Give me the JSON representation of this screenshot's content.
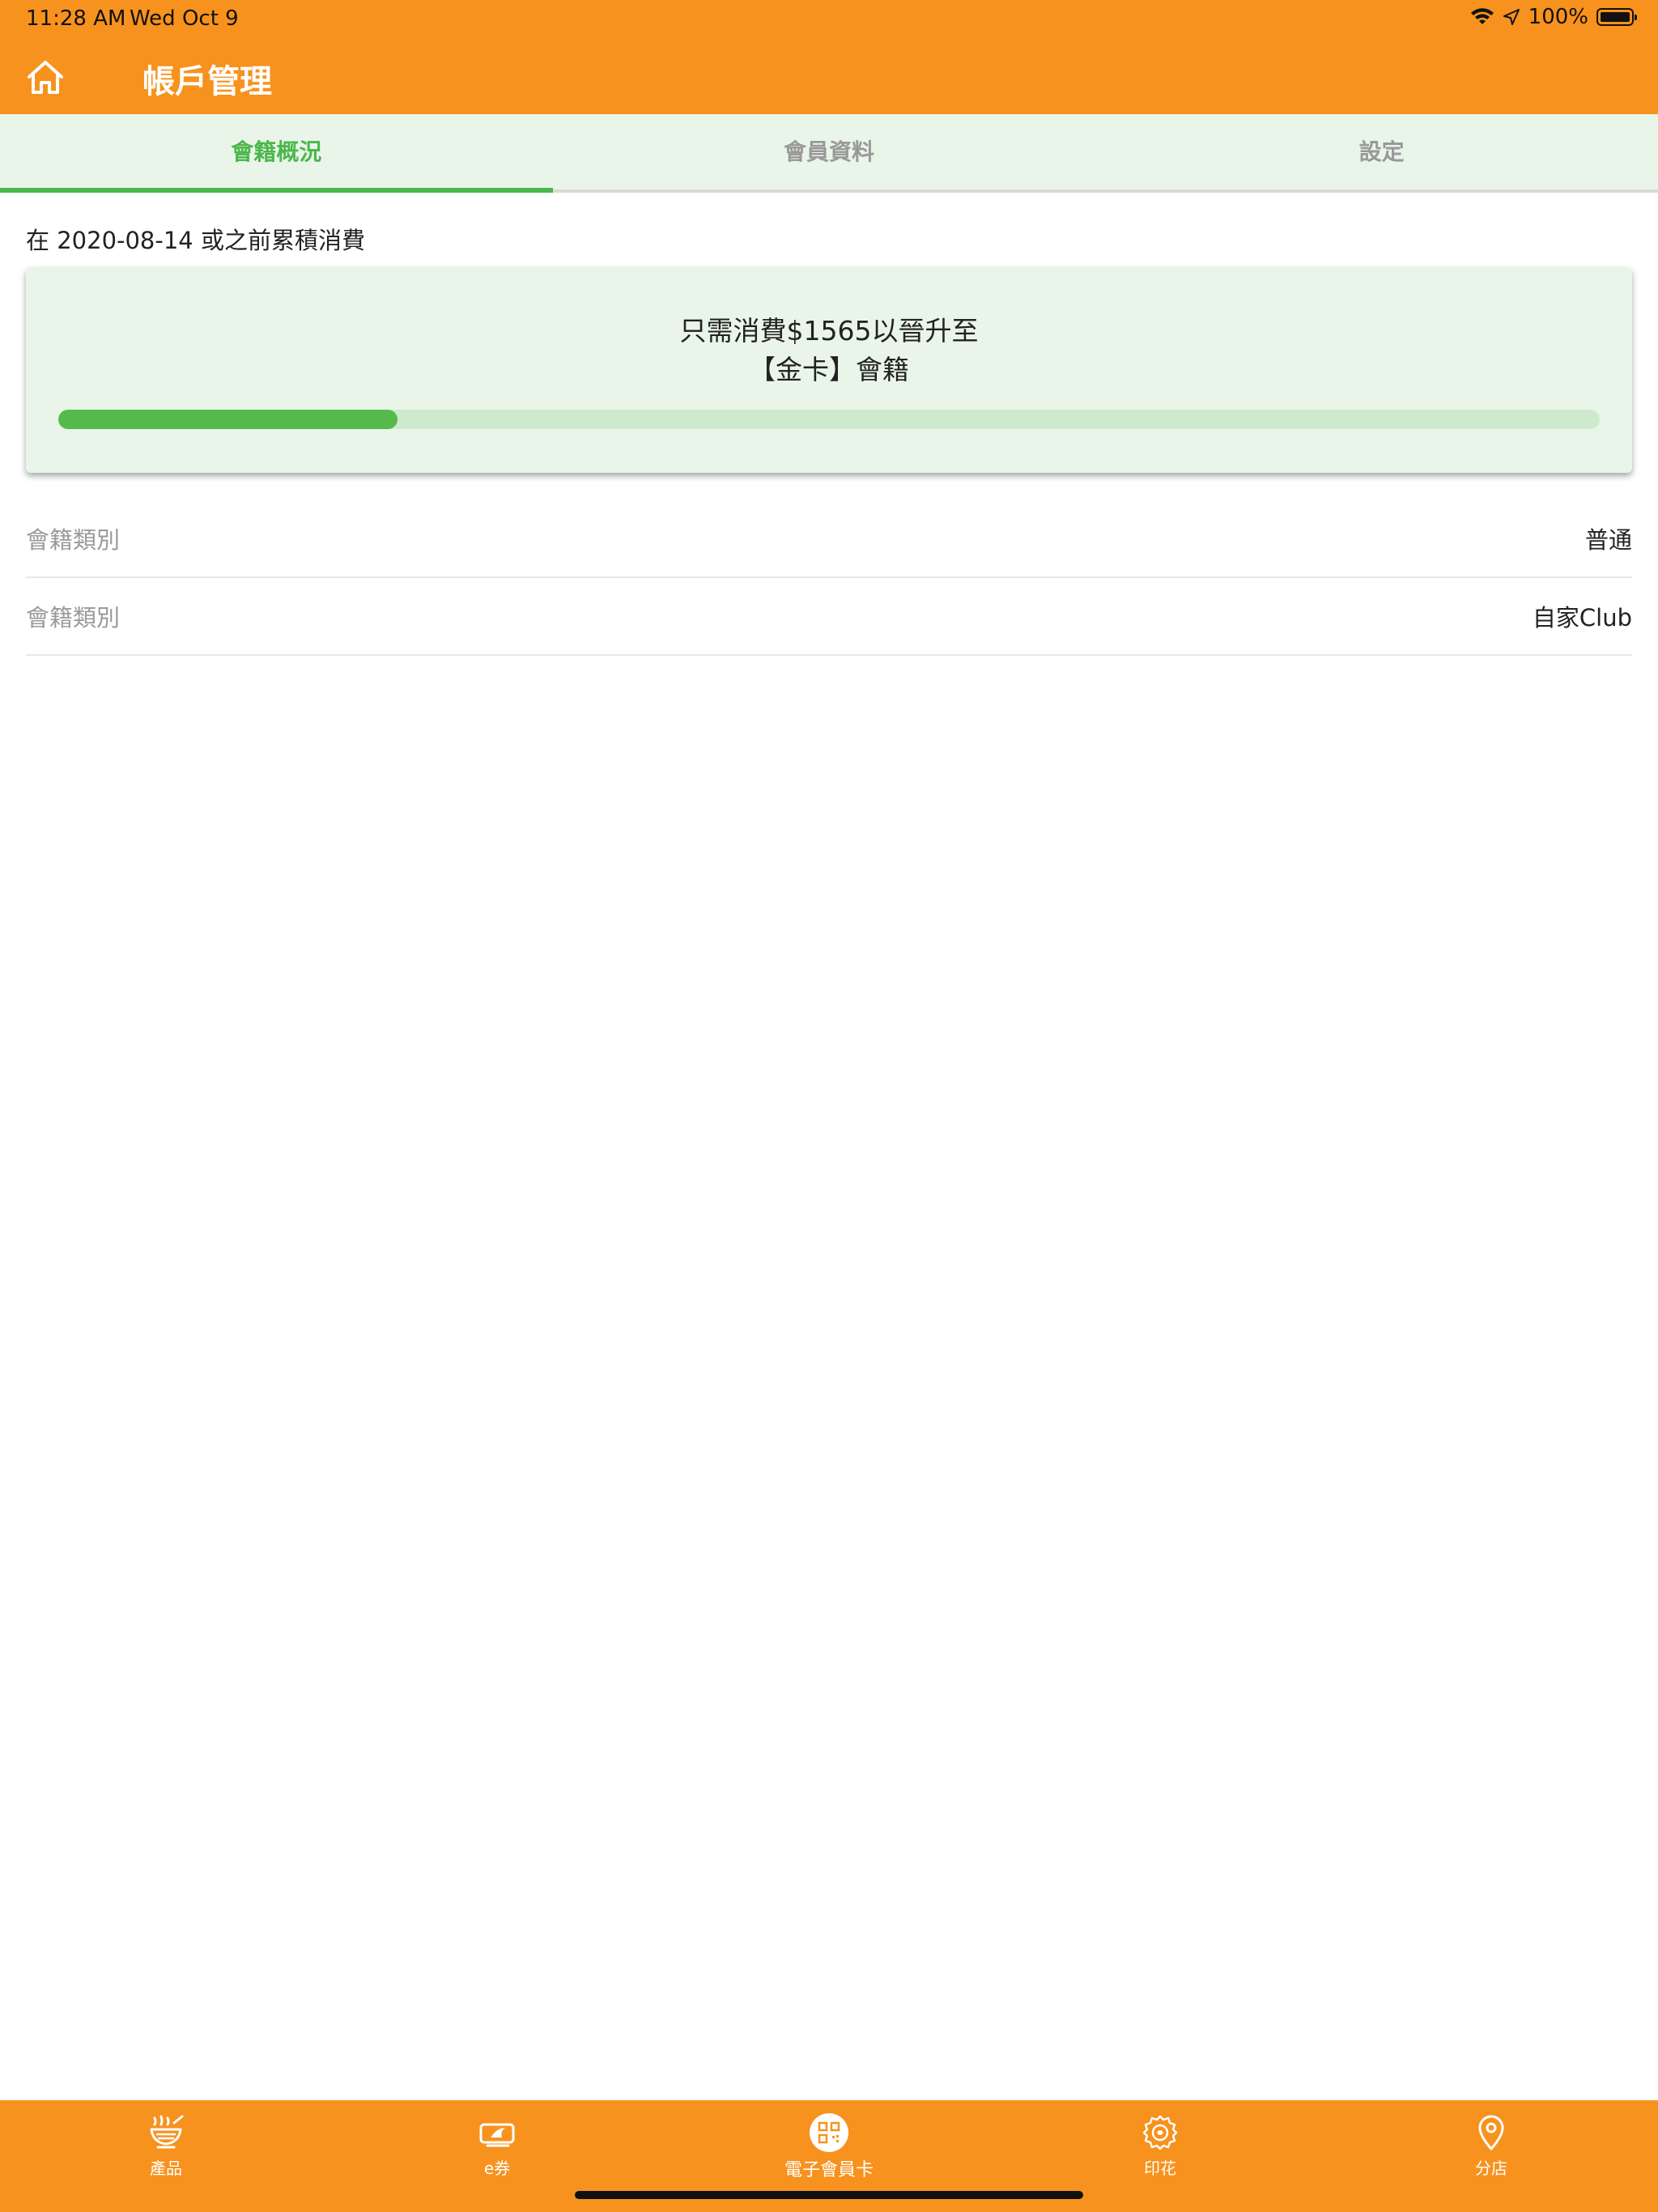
{
  "status_bar": {
    "time": "11:28 AM",
    "date": "Wed Oct 9",
    "battery": "100%"
  },
  "header": {
    "title": "帳戶管理",
    "home_icon": "home-icon"
  },
  "tabs": [
    {
      "label": "會籍概況",
      "active": true
    },
    {
      "label": "會員資料",
      "active": false
    },
    {
      "label": "設定",
      "active": false
    }
  ],
  "summary": {
    "since_text": "在 2020-08-14 或之前累積消費",
    "upgrade_line1": "只需消費$1565以晉升至",
    "upgrade_line2": "【金卡】會籍",
    "progress": 0.22
  },
  "info_rows": [
    {
      "label": "會籍類別",
      "value": "普通"
    },
    {
      "label": "會籍類別",
      "value": "自家Club"
    }
  ],
  "bottom_nav": [
    {
      "label": "產品",
      "icon": "noodle-bowl-icon"
    },
    {
      "label": "e券",
      "icon": "coupon-icon"
    },
    {
      "label": "電子會員卡",
      "icon": "qr-code-icon"
    },
    {
      "label": "印花",
      "icon": "stamp-icon"
    },
    {
      "label": "分店",
      "icon": "location-pin-icon"
    }
  ],
  "colors": {
    "brand_orange": "#f7921e",
    "accent_green": "#4cb74b",
    "tab_background": "#eaf5ea"
  }
}
